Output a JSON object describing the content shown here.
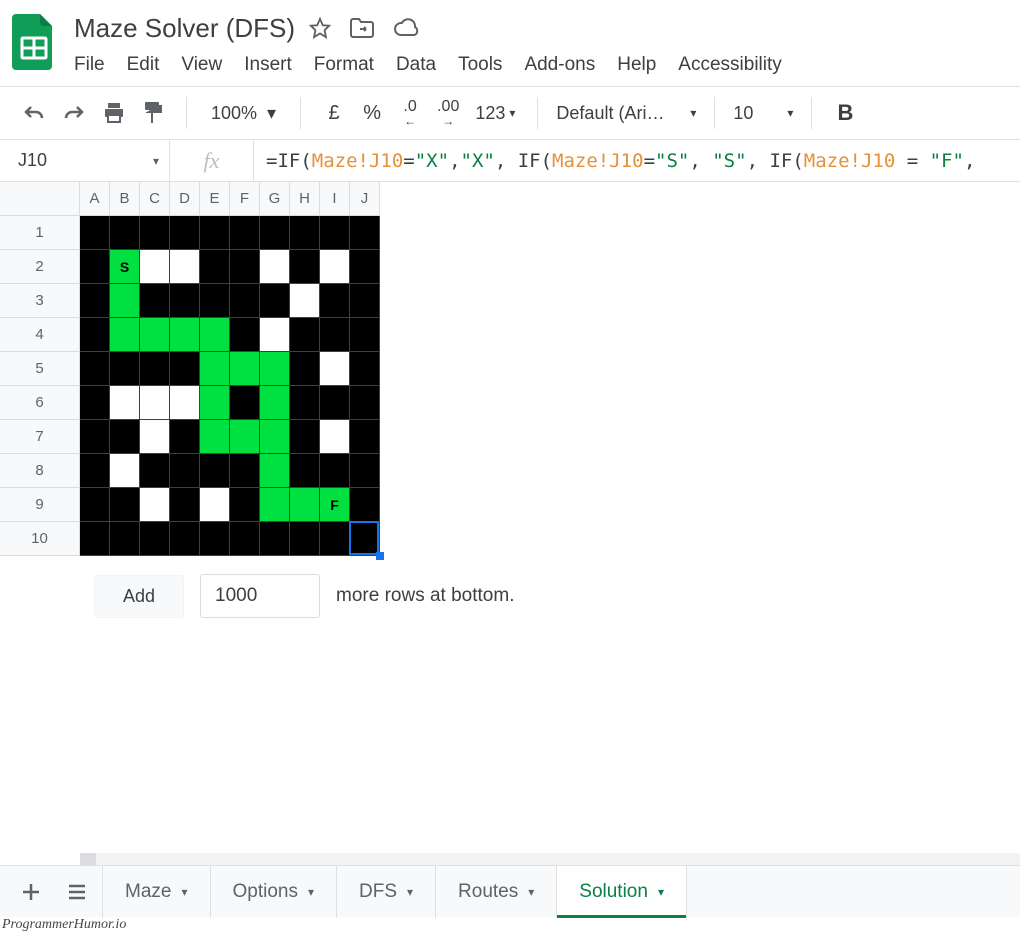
{
  "header": {
    "title": "Maze Solver (DFS)"
  },
  "menubar": [
    "File",
    "Edit",
    "View",
    "Insert",
    "Format",
    "Data",
    "Tools",
    "Add-ons",
    "Help",
    "Accessibility"
  ],
  "toolbar": {
    "zoom": "100%",
    "currency": "£",
    "percent": "%",
    "dec_dec": ".0",
    "inc_dec": ".00",
    "numfmt": "123",
    "font": "Default (Ari…",
    "font_size": "10",
    "bold": "B"
  },
  "formula_bar": {
    "name_box": "J10",
    "parts": [
      {
        "t": "fn",
        "v": "=IF("
      },
      {
        "t": "ref",
        "v": "Maze!J10"
      },
      {
        "t": "fn",
        "v": "="
      },
      {
        "t": "str",
        "v": "\"X\""
      },
      {
        "t": "fn",
        "v": ","
      },
      {
        "t": "str",
        "v": "\"X\""
      },
      {
        "t": "fn",
        "v": ", IF("
      },
      {
        "t": "ref",
        "v": "Maze!J10"
      },
      {
        "t": "fn",
        "v": "="
      },
      {
        "t": "str",
        "v": "\"S\""
      },
      {
        "t": "fn",
        "v": ", "
      },
      {
        "t": "str",
        "v": "\"S\""
      },
      {
        "t": "fn",
        "v": ", IF("
      },
      {
        "t": "ref",
        "v": "Maze!J10"
      },
      {
        "t": "fn",
        "v": " = "
      },
      {
        "t": "str",
        "v": "\"F\""
      },
      {
        "t": "fn",
        "v": ","
      }
    ]
  },
  "sheet": {
    "columns": [
      "A",
      "B",
      "C",
      "D",
      "E",
      "F",
      "G",
      "H",
      "I",
      "J"
    ],
    "rows": [
      "1",
      "2",
      "3",
      "4",
      "5",
      "6",
      "7",
      "8",
      "9",
      "10"
    ],
    "active_cell": {
      "row": 10,
      "col": 10
    },
    "cells": [
      [
        "b",
        "b",
        "b",
        "b",
        "b",
        "b",
        "b",
        "b",
        "b",
        "b"
      ],
      [
        "b",
        "gS",
        "w",
        "w",
        "b",
        "b",
        "w",
        "b",
        "w",
        "b"
      ],
      [
        "b",
        "g",
        "b",
        "b",
        "b",
        "b",
        "b",
        "w",
        "b",
        "b"
      ],
      [
        "b",
        "g",
        "g",
        "g",
        "g",
        "b",
        "w",
        "b",
        "b",
        "b"
      ],
      [
        "b",
        "b",
        "b",
        "b",
        "g",
        "g",
        "g",
        "b",
        "w",
        "b"
      ],
      [
        "b",
        "w",
        "w",
        "w",
        "g",
        "b",
        "g",
        "b",
        "b",
        "b"
      ],
      [
        "b",
        "b",
        "w",
        "b",
        "g",
        "g",
        "g",
        "b",
        "w",
        "b"
      ],
      [
        "b",
        "w",
        "b",
        "b",
        "b",
        "b",
        "g",
        "b",
        "b",
        "b"
      ],
      [
        "b",
        "b",
        "w",
        "b",
        "w",
        "b",
        "g",
        "g",
        "gF",
        "b"
      ],
      [
        "b",
        "b",
        "b",
        "b",
        "b",
        "b",
        "b",
        "b",
        "b",
        "b"
      ]
    ]
  },
  "addrows": {
    "button": "Add",
    "value": "1000",
    "suffix": "more rows at bottom."
  },
  "tabs": [
    {
      "label": "Maze",
      "active": false
    },
    {
      "label": "Options",
      "active": false
    },
    {
      "label": "DFS",
      "active": false
    },
    {
      "label": "Routes",
      "active": false
    },
    {
      "label": "Solution",
      "active": true
    }
  ],
  "watermark": "ProgrammerHumor.io"
}
